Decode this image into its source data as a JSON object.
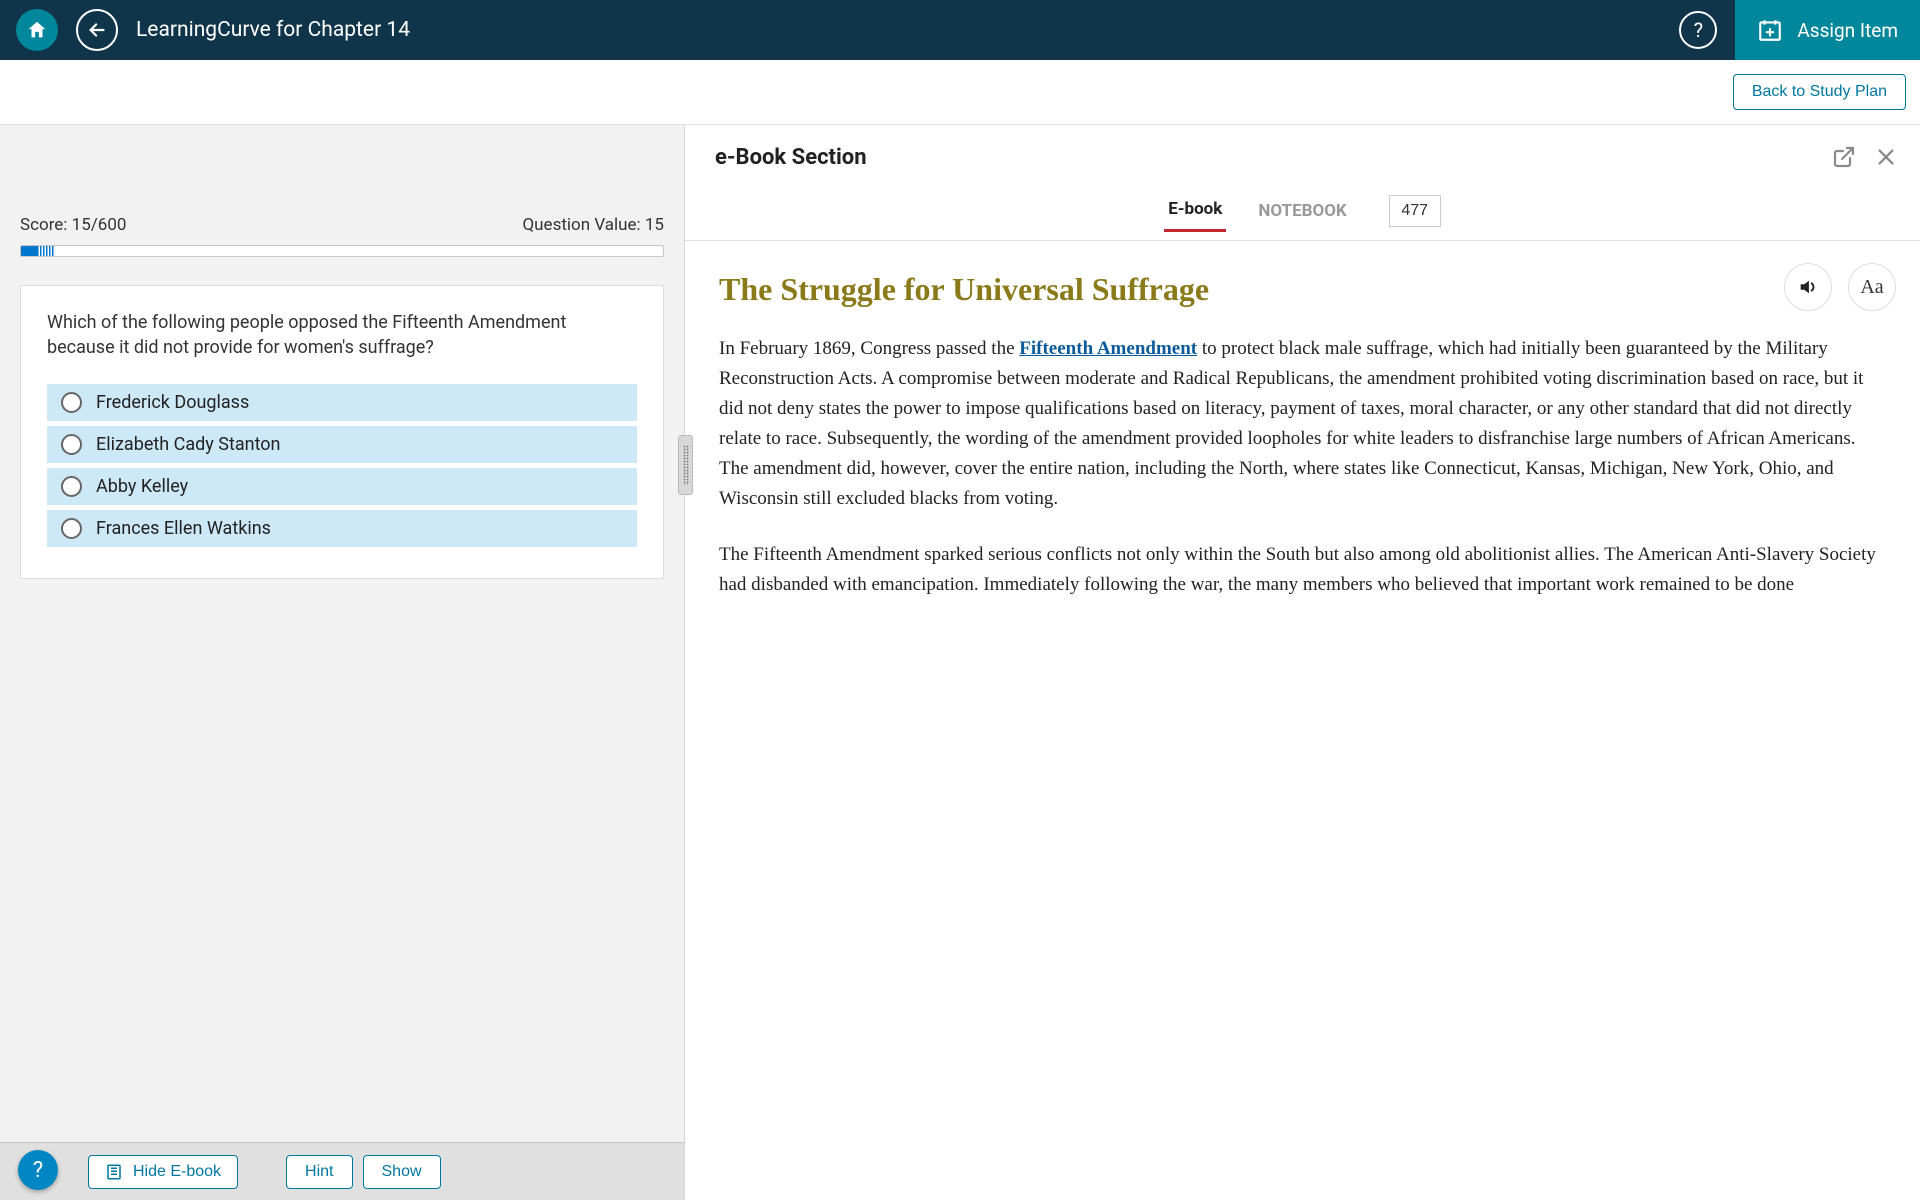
{
  "header": {
    "title": "LearningCurve for Chapter 14",
    "assign_label": "Assign Item"
  },
  "subheader": {
    "study_plan_label": "Back to Study Plan"
  },
  "quiz": {
    "score_label": "Score: 15/600",
    "question_value_label": "Question Value: 15",
    "question_text": "Which of the following people opposed the Fifteenth Amendment because it did not provide for women's suffrage?",
    "options": [
      "Frederick Douglass",
      "Elizabeth Cady Stanton",
      "Abby Kelley",
      "Frances Ellen Watkins"
    ]
  },
  "actions": {
    "hide_ebook": "Hide E-book",
    "hint": "Hint",
    "show": "Show"
  },
  "ebook": {
    "section_title": "e-Book Section",
    "tabs": {
      "ebook": "E-book",
      "notebook": "NOTEBOOK"
    },
    "page": "477",
    "heading": "The Struggle for Universal Suffrage",
    "link_term": "Fifteenth Amendment",
    "p1_pre": "In February 1869, Congress passed the ",
    "p1_post": " to protect black male suffrage, which had initially been guaranteed by the Military Reconstruction Acts. A compromise between moderate and Radical Republicans, the amendment prohibited voting discrimination based on race, but it did not deny states the power to impose qualifications based on literacy, payment of taxes, moral character, or any other standard that did not directly relate to race. Subsequently, the wording of the amendment provided loopholes for white leaders to disfranchise large numbers of African Americans. The amendment did, however, cover the entire nation, including the North, where states like Connecticut, Kansas, Michigan, New York, Ohio, and Wisconsin still excluded blacks from voting.",
    "p2": "The Fifteenth Amendment sparked serious conflicts not only within the South but also among old abolitionist allies. The American Anti-Slavery Society had disbanded with emancipation. Immediately following the war, the many members who believed that important work remained to be done"
  },
  "font_button_label": "Aa"
}
